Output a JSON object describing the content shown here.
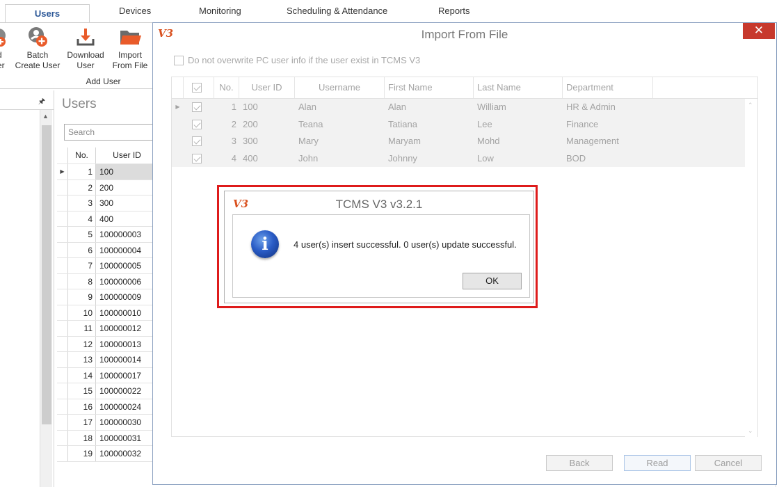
{
  "menubar": {
    "tabs": [
      {
        "label": "Users"
      },
      {
        "label": "Devices"
      },
      {
        "label": "Monitoring"
      },
      {
        "label": "Scheduling & Attendance"
      },
      {
        "label": "Reports"
      }
    ]
  },
  "ribbon": {
    "add_user_partial_1": "d",
    "add_user_partial_2": "er",
    "batch_create_1": "Batch",
    "batch_create_2": "Create User",
    "download_1": "Download",
    "download_2": "User",
    "import_1": "Import",
    "import_2": "From File",
    "group_label": "Add User"
  },
  "users_pane": {
    "title": "Users",
    "search_placeholder": "Search",
    "col_no": "No.",
    "col_uid": "User ID",
    "rows": [
      {
        "no": "1",
        "uid": "100"
      },
      {
        "no": "2",
        "uid": "200"
      },
      {
        "no": "3",
        "uid": "300"
      },
      {
        "no": "4",
        "uid": "400"
      },
      {
        "no": "5",
        "uid": "100000003"
      },
      {
        "no": "6",
        "uid": "100000004"
      },
      {
        "no": "7",
        "uid": "100000005"
      },
      {
        "no": "8",
        "uid": "100000006"
      },
      {
        "no": "9",
        "uid": "100000009"
      },
      {
        "no": "10",
        "uid": "100000010"
      },
      {
        "no": "11",
        "uid": "100000012"
      },
      {
        "no": "12",
        "uid": "100000013"
      },
      {
        "no": "13",
        "uid": "100000014"
      },
      {
        "no": "14",
        "uid": "100000017"
      },
      {
        "no": "15",
        "uid": "100000022"
      },
      {
        "no": "16",
        "uid": "100000024"
      },
      {
        "no": "17",
        "uid": "100000030"
      },
      {
        "no": "18",
        "uid": "100000031"
      },
      {
        "no": "19",
        "uid": "100000032"
      }
    ]
  },
  "import_dialog": {
    "logo": "V3",
    "title": "Import From File",
    "close": "✕",
    "overwrite_label": "Do not overwrite PC user info if the user exist in TCMS V3",
    "columns": {
      "no": "No.",
      "uid": "User ID",
      "username": "Username",
      "first": "First Name",
      "last": "Last Name",
      "dept": "Department"
    },
    "rows": [
      {
        "no": "1",
        "uid": "100",
        "username": "Alan",
        "first": "Alan",
        "last": "William",
        "dept": "HR & Admin"
      },
      {
        "no": "2",
        "uid": "200",
        "username": "Teana",
        "first": "Tatiana",
        "last": "Lee",
        "dept": "Finance"
      },
      {
        "no": "3",
        "uid": "300",
        "username": "Mary",
        "first": "Maryam",
        "last": "Mohd",
        "dept": "Management"
      },
      {
        "no": "4",
        "uid": "400",
        "username": "John",
        "first": "Johnny",
        "last": "Low",
        "dept": "BOD"
      }
    ],
    "back_label": "Back",
    "read_label": "Read",
    "cancel_label": "Cancel"
  },
  "message_box": {
    "logo": "V3",
    "title": "TCMS V3 v3.2.1",
    "icon_glyph": "i",
    "message": "4 user(s) insert successful. 0 user(s) update successful.",
    "ok_label": "OK"
  },
  "colors": {
    "accent": "#2b5797",
    "close": "#c7392d",
    "highlight": "#de1b1b",
    "logo": "#d9501e"
  }
}
